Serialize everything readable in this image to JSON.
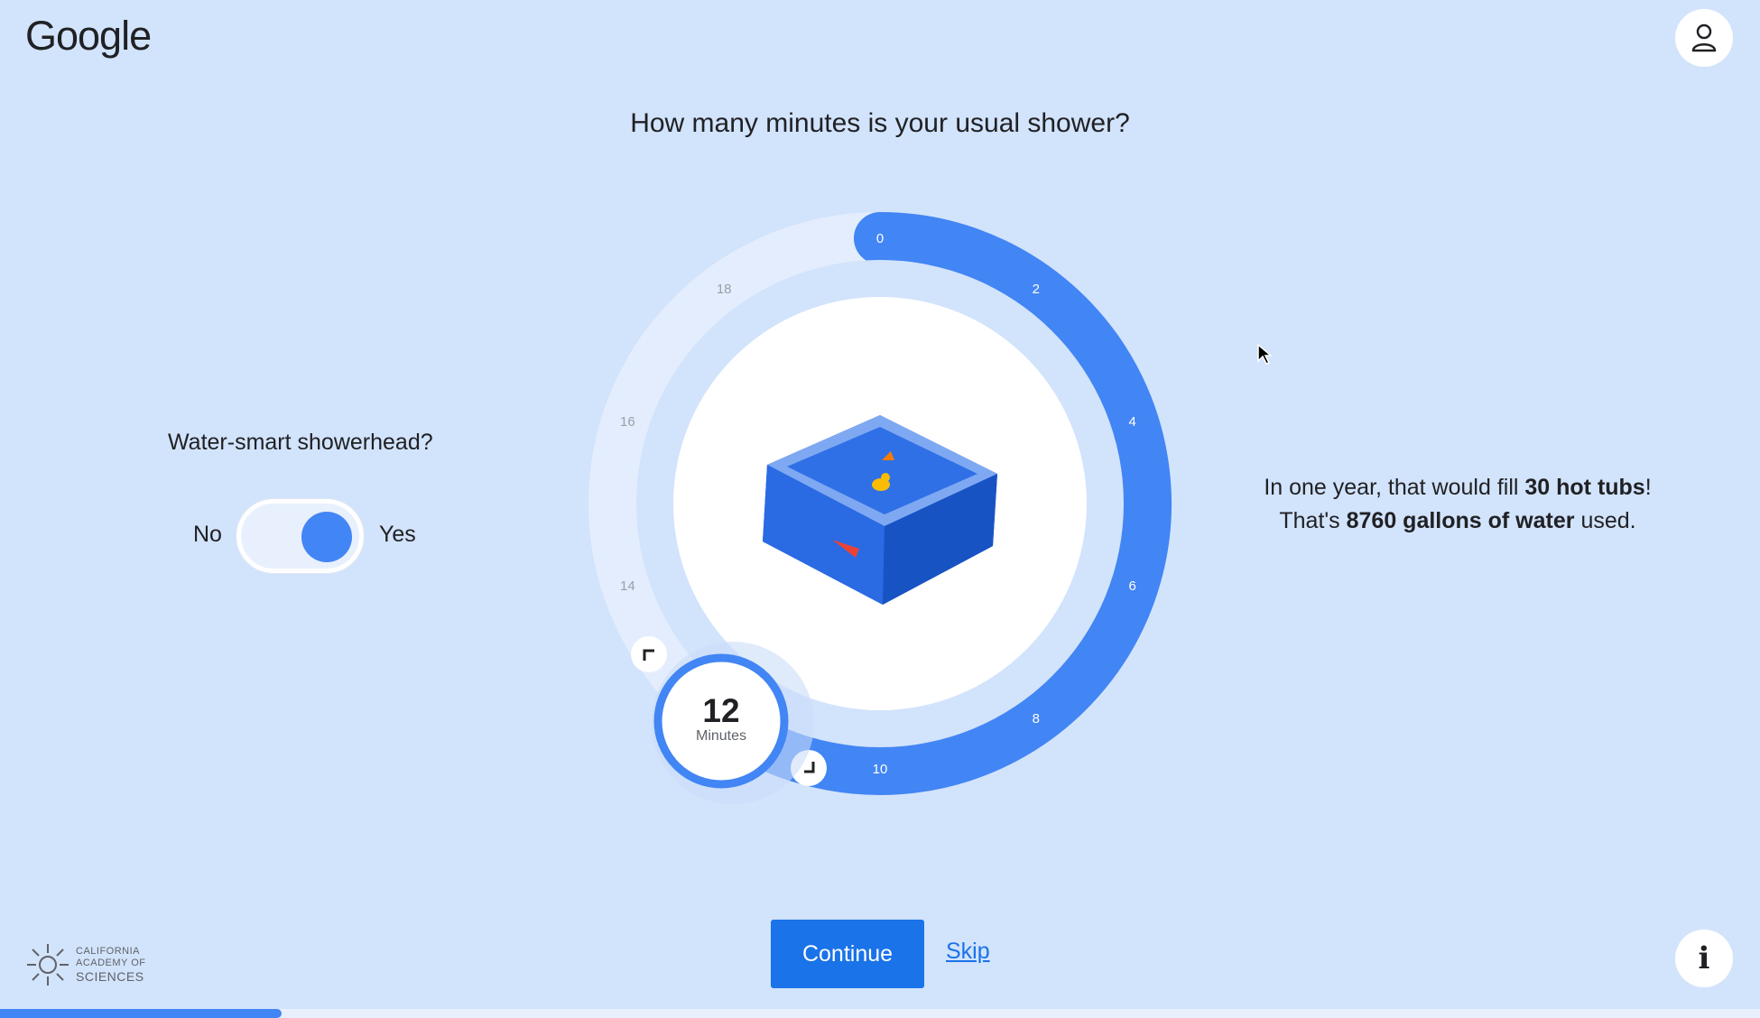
{
  "header": {
    "logo_text": "Google",
    "avatar_icon": "person-icon"
  },
  "question": "How many minutes is your usual shower?",
  "showerhead": {
    "label": "Water-smart showerhead?",
    "no_label": "No",
    "yes_label": "Yes",
    "value": "Yes"
  },
  "dial": {
    "ticks": [
      "0",
      "2",
      "4",
      "6",
      "8",
      "10",
      "14",
      "16",
      "18"
    ],
    "value": "12",
    "unit": "Minutes",
    "max": 20,
    "colors": {
      "active": "#4285f4",
      "track": "#e3edfd"
    }
  },
  "result": {
    "line1_prefix": "In one year, that would fill ",
    "line1_bold": "30 hot tubs",
    "line1_suffix": "!",
    "line2_prefix": "That's ",
    "line2_bold": "8760 gallons of water",
    "line2_suffix": " used."
  },
  "footer": {
    "continue_label": "Continue",
    "skip_label": "Skip",
    "academy": {
      "line1": "CALIFORNIA",
      "line2": "ACADEMY OF",
      "line3": "SCIENCES"
    },
    "info_label": "i",
    "progress": 0.16
  },
  "colors": {
    "background": "#d2e3fc",
    "accent": "#4285f4",
    "button": "#1a73e8"
  }
}
